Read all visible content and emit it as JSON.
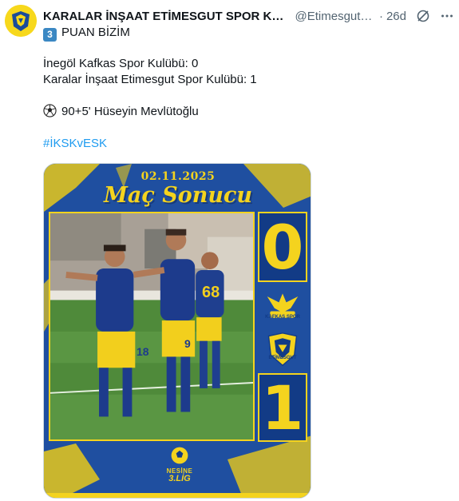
{
  "post": {
    "author_name": "KARALAR İNŞAAT ETİMESGUT SPOR KULÜBÜ",
    "handle": "@Etimesgutspor",
    "separator": "·",
    "time": "26d",
    "avatar": "club-crest-avatar",
    "icons": {
      "grok": "grok-icon",
      "more": "more-icon"
    },
    "keycap_number": "3",
    "lines": {
      "headline": "PUAN BİZİM",
      "home_result": "İnegöl Kafkas Spor Kulübü: 0",
      "away_result": "Karalar İnşaat Etimesgut Spor Kulübü: 1",
      "goal": "90+5' Hüseyin Mevlütoğlu",
      "hashtag": "#İKSKvESK"
    }
  },
  "media": {
    "date": "02.11.2025",
    "title": "Maç Sonucu",
    "home_score": "0",
    "away_score": "1",
    "home_team": "KAFKAS SPOR",
    "away_team": "ETİMESGUT",
    "league_name": "NESİNE",
    "league_tier": "3.LİG",
    "player_numbers": {
      "left_player": "18",
      "middle_player": "9",
      "back_player": "68"
    },
    "colors": {
      "navy": "#123b86",
      "yellow": "#f4d31e",
      "link": "#1d9bf0"
    }
  }
}
